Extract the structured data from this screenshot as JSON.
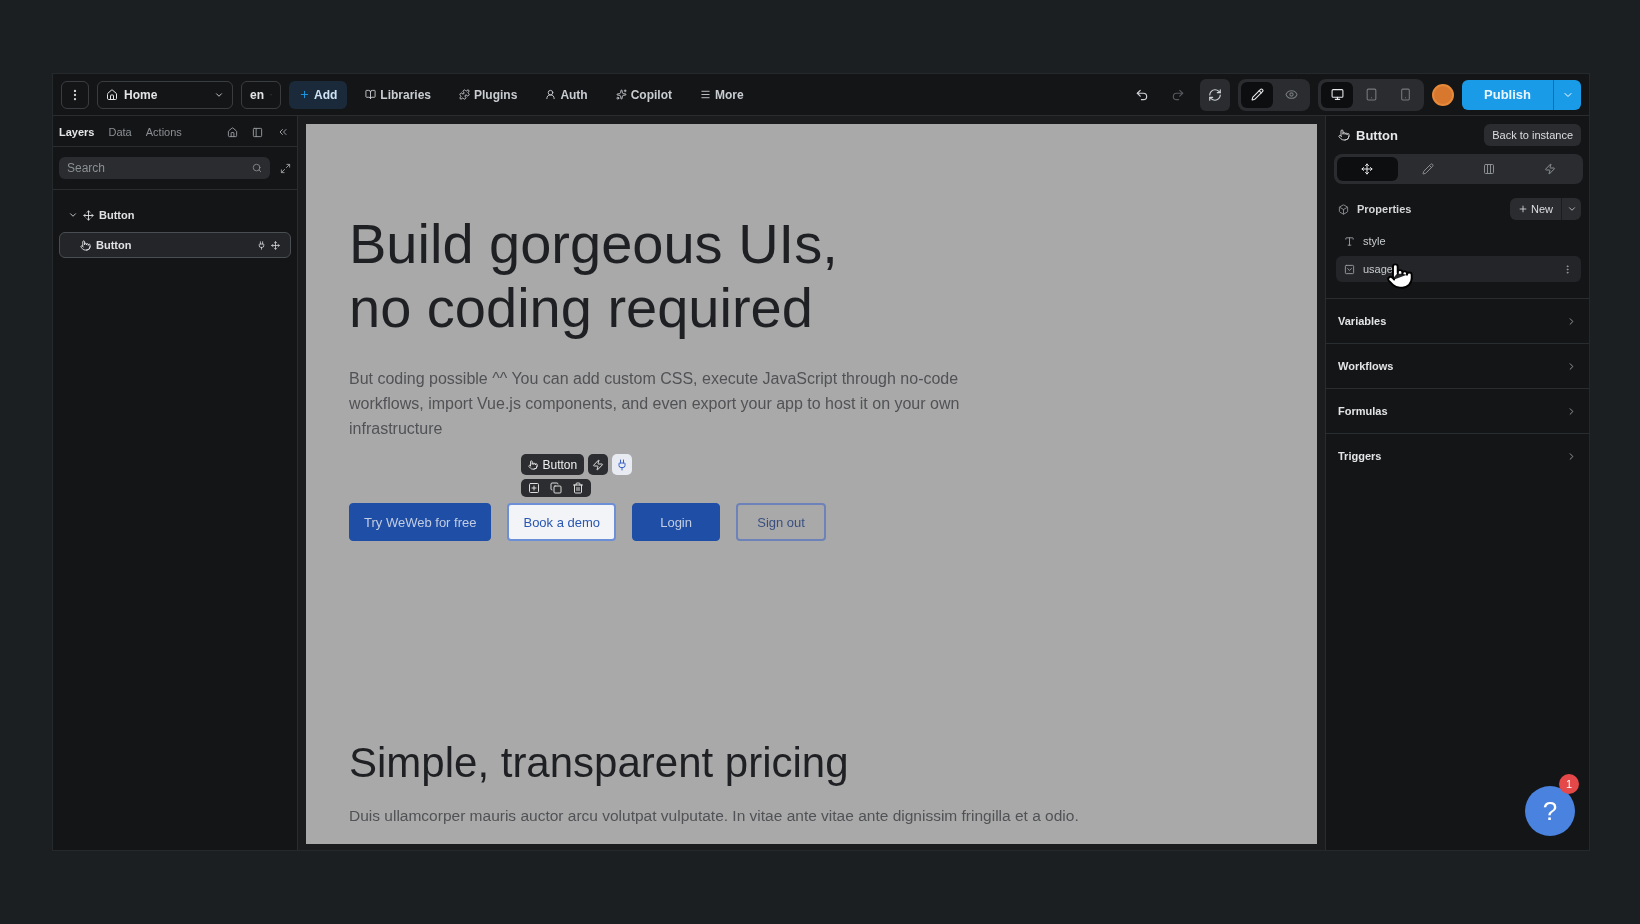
{
  "toolbar": {
    "page": "Home",
    "lang": "en",
    "actions": [
      {
        "label": "Add",
        "selected": true
      },
      {
        "label": "Libraries",
        "selected": false
      },
      {
        "label": "Plugins",
        "selected": false
      },
      {
        "label": "Auth",
        "selected": false
      },
      {
        "label": "Copilot",
        "selected": false
      },
      {
        "label": "More",
        "selected": false
      }
    ],
    "modes": [
      {
        "selected": true
      },
      {
        "selected": false
      }
    ],
    "devices": [
      {
        "selected": true
      },
      {
        "selected": false
      },
      {
        "selected": false
      }
    ],
    "publish": "Publish"
  },
  "left_panel": {
    "tabs": [
      {
        "label": "Layers",
        "selected": true
      },
      {
        "label": "Data",
        "selected": false
      },
      {
        "label": "Actions",
        "selected": false
      }
    ],
    "search": {
      "placeholder": "Search"
    },
    "tree": [
      {
        "label": "Button",
        "expanded": true,
        "selected": false,
        "children": [
          {
            "label": "Button",
            "selected": true
          }
        ]
      }
    ]
  },
  "canvas": {
    "heading": [
      "Build gorgeous UIs,",
      "no coding required"
    ],
    "paragraph": "But coding possible ^^ You can add custom CSS, execute JavaScript through no-code workflows, import Vue.js components, and even export your app to host it on your own infrastructure",
    "buttons": [
      {
        "label": "Try WeWeb for free",
        "kind": "primary",
        "selected": false
      },
      {
        "label": "Book a demo",
        "kind": "secondary",
        "selected": true
      },
      {
        "label": "Login",
        "kind": "primary",
        "selected": false
      },
      {
        "label": "Sign out",
        "kind": "outline",
        "selected": false
      }
    ],
    "element_toolbar": {
      "label": "Button"
    },
    "section_heading": "Simple, transparent pricing",
    "section_text": "Duis ullamcorper mauris auctor arcu volutpat vulputate. In vitae ante vitae ante dignissim fringilla et a odio."
  },
  "right_panel": {
    "title": "Button",
    "back": "Back to instance",
    "tabs": [
      {
        "selected": true
      },
      {
        "selected": false
      },
      {
        "selected": false
      },
      {
        "selected": false
      }
    ],
    "properties": {
      "title": "Properties",
      "new": "New",
      "items": [
        {
          "label": "style",
          "kind": "text",
          "highlighted": false
        },
        {
          "label": "usage",
          "kind": "select",
          "highlighted": true
        }
      ]
    },
    "sections": [
      {
        "label": "Variables"
      },
      {
        "label": "Workflows"
      },
      {
        "label": "Formulas"
      },
      {
        "label": "Triggers"
      }
    ]
  },
  "help": {
    "label": "?",
    "badge": "1"
  }
}
